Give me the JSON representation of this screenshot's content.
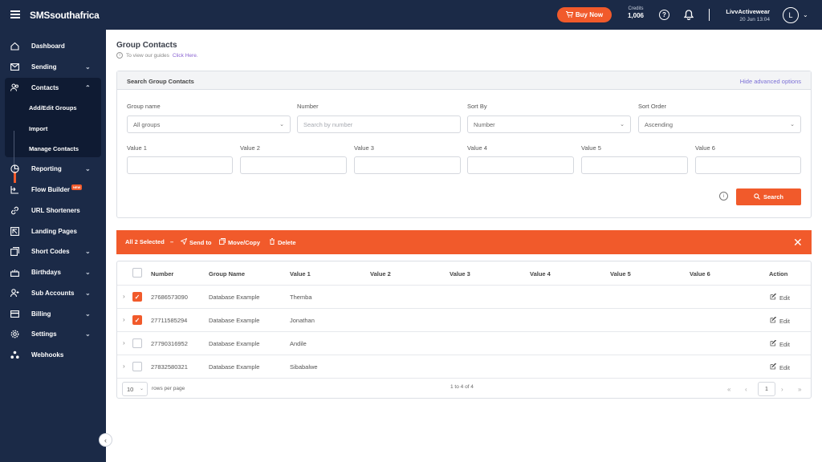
{
  "topbar": {
    "logo": "SMSsouthafrica",
    "buy_now": "Buy Now",
    "credits_label": "Credits",
    "credits_value": "1,006",
    "user_name": "LivvActivewear",
    "user_date": "20 Jun 13:04",
    "avatar_letter": "L"
  },
  "sidebar": {
    "items": [
      {
        "label": "Dashboard",
        "icon": "home-icon"
      },
      {
        "label": "Sending",
        "icon": "mail-icon"
      },
      {
        "label": "Contacts",
        "icon": "users-icon"
      },
      {
        "label": "Reporting",
        "icon": "chart-icon"
      },
      {
        "label": "Flow Builder",
        "icon": "flow-icon",
        "badge": "NEW"
      },
      {
        "label": "URL Shorteners",
        "icon": "link-icon"
      },
      {
        "label": "Landing Pages",
        "icon": "page-icon"
      },
      {
        "label": "Short Codes",
        "icon": "code-icon"
      },
      {
        "label": "Birthdays",
        "icon": "cake-icon"
      },
      {
        "label": "Sub Accounts",
        "icon": "user-plus-icon"
      },
      {
        "label": "Billing",
        "icon": "card-icon"
      },
      {
        "label": "Settings",
        "icon": "gear-icon"
      },
      {
        "label": "Webhooks",
        "icon": "webhook-icon"
      }
    ],
    "contacts_sub": [
      "Add/Edit Groups",
      "Import",
      "Manage Contacts"
    ]
  },
  "page": {
    "title": "Group Contacts",
    "guides_text": "To view our guides",
    "guides_link": "Click Here."
  },
  "search": {
    "header": "Search Group Contacts",
    "toggle": "Hide advanced options",
    "group_name_label": "Group name",
    "group_name_value": "All groups",
    "number_label": "Number",
    "number_placeholder": "Search by number",
    "sort_by_label": "Sort By",
    "sort_by_value": "Number",
    "sort_order_label": "Sort Order",
    "sort_order_value": "Ascending",
    "value_labels": [
      "Value 1",
      "Value 2",
      "Value 3",
      "Value 4",
      "Value 5",
      "Value 6"
    ],
    "search_button": "Search"
  },
  "selection": {
    "all_selected": "All 2 Selected",
    "dash": "–",
    "send_to": "Send to",
    "move_copy": "Move/Copy",
    "delete": "Delete"
  },
  "table": {
    "headers": [
      "Number",
      "Group Name",
      "Value 1",
      "Value 2",
      "Value 3",
      "Value 4",
      "Value 5",
      "Value 6",
      "Action"
    ],
    "rows": [
      {
        "number": "27686573090",
        "group": "Database Example",
        "value1": "Themba",
        "checked": true,
        "action": "Edit"
      },
      {
        "number": "27711585294",
        "group": "Database Example",
        "value1": "Jonathan",
        "checked": true,
        "action": "Edit"
      },
      {
        "number": "27790316952",
        "group": "Database Example",
        "value1": "Andile",
        "checked": false,
        "action": "Edit"
      },
      {
        "number": "27832580321",
        "group": "Database Example",
        "value1": "Sibabalwe",
        "checked": false,
        "action": "Edit"
      }
    ],
    "rows_per_page_value": "10",
    "rows_per_page_label": "rows per page",
    "range_text": "1 to 4 of 4",
    "current_page": "1"
  },
  "colors": {
    "navy": "#1b2a47",
    "accent": "#f15a2b",
    "link": "#7b6fd6"
  }
}
